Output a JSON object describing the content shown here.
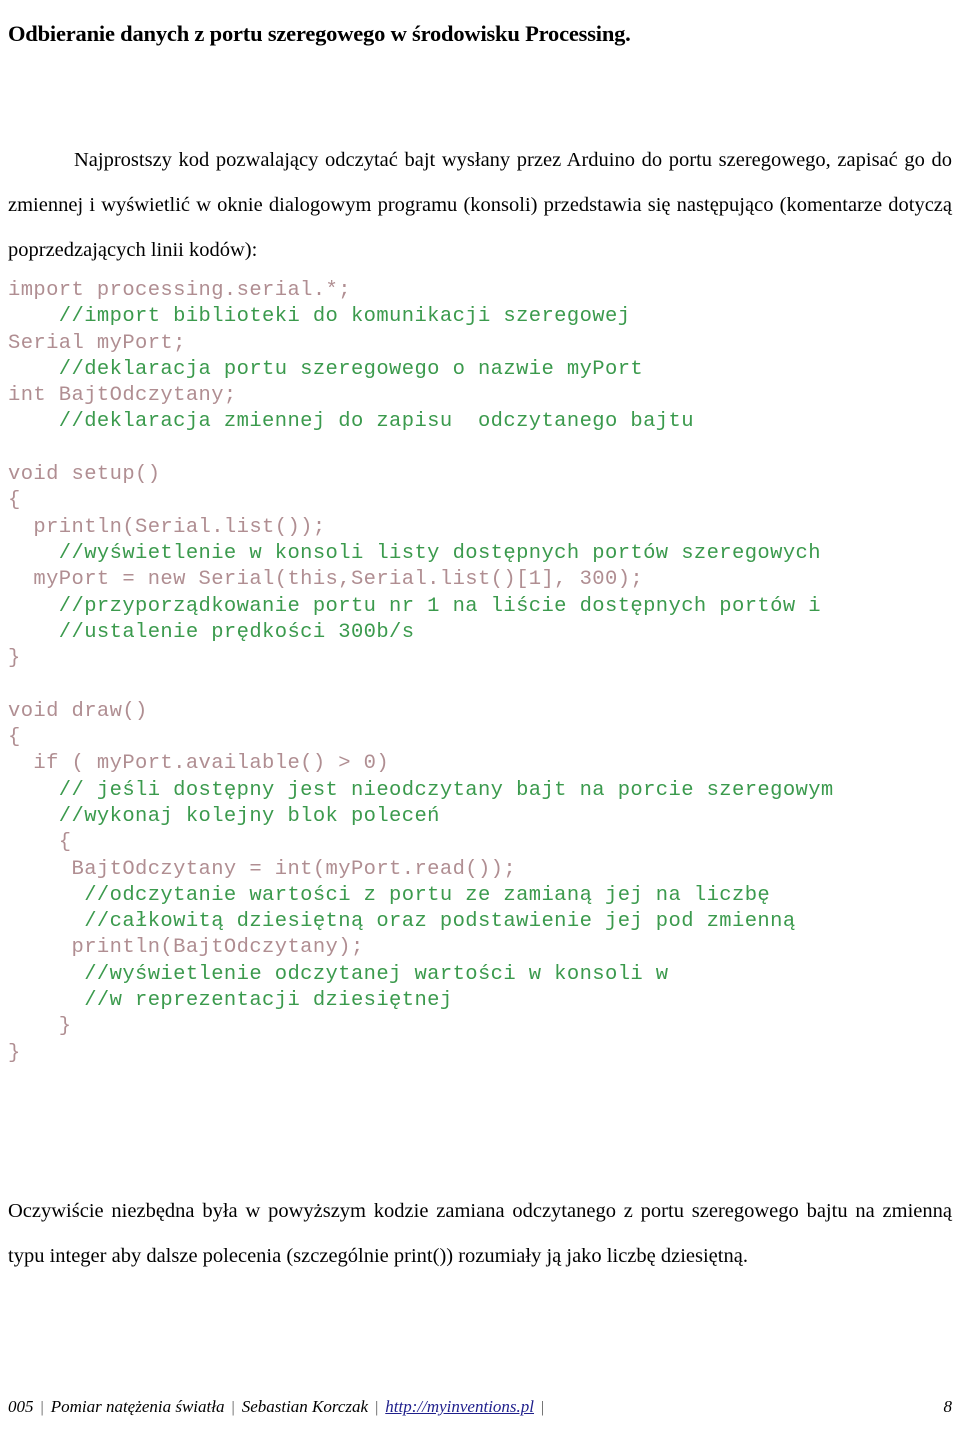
{
  "document": {
    "title": "Odbieranie danych z portu szeregowego w środowisku Processing.",
    "intro_paragraph": "Najprostszy kod pozwalający odczytać bajt wysłany przez Arduino do portu szeregowego, zapisać go do zmiennej i wyświetlić w oknie dialogowym programu (konsoli) przedstawia się następująco (komentarze dotyczą poprzedzających linii kodów):",
    "outro_paragraph": "Oczywiście niezbędna była w powyższym kodzie zamiana odczytanego z portu szeregowego bajtu na zmienną typu integer aby dalsze polecenia (szczególnie print()) rozumiały ją jako liczbę dziesiętną."
  },
  "colors": {
    "code": "#b08e92",
    "comment": "#3b9a4d",
    "link": "#1f1f8c",
    "text": "#000000",
    "background": "#ffffff"
  },
  "code_block": {
    "language": "Processing",
    "lines": [
      {
        "kind": "code",
        "text": "import processing.serial.*;"
      },
      {
        "kind": "comment",
        "text": "    //import biblioteki do komunikacji szeregowej"
      },
      {
        "kind": "code",
        "text": "Serial myPort;"
      },
      {
        "kind": "comment",
        "text": "    //deklaracja portu szeregowego o nazwie myPort"
      },
      {
        "kind": "code",
        "text": "int BajtOdczytany;"
      },
      {
        "kind": "comment",
        "text": "    //deklaracja zmiennej do zapisu  odczytanego bajtu"
      },
      {
        "kind": "blank",
        "text": " "
      },
      {
        "kind": "code",
        "text": "void setup()"
      },
      {
        "kind": "code",
        "text": "{"
      },
      {
        "kind": "code",
        "text": "  println(Serial.list());"
      },
      {
        "kind": "comment",
        "text": "    //wyświetlenie w konsoli listy dostępnych portów szeregowych"
      },
      {
        "kind": "code",
        "text": "  myPort = new Serial(this,Serial.list()[1], 300);"
      },
      {
        "kind": "comment",
        "text": "    //przyporządkowanie portu nr 1 na liście dostępnych portów i"
      },
      {
        "kind": "comment",
        "text": "    //ustalenie prędkości 300b/s"
      },
      {
        "kind": "code",
        "text": "}"
      },
      {
        "kind": "blank",
        "text": " "
      },
      {
        "kind": "code",
        "text": "void draw()"
      },
      {
        "kind": "code",
        "text": "{"
      },
      {
        "kind": "code",
        "text": "  if ( myPort.available() > 0)"
      },
      {
        "kind": "comment",
        "text": "    // jeśli dostępny jest nieodczytany bajt na porcie szeregowym"
      },
      {
        "kind": "comment",
        "text": "    //wykonaj kolejny blok poleceń"
      },
      {
        "kind": "code",
        "text": "    {"
      },
      {
        "kind": "code",
        "text": "     BajtOdczytany = int(myPort.read());"
      },
      {
        "kind": "comment",
        "text": "      //odczytanie wartości z portu ze zamianą jej na liczbę"
      },
      {
        "kind": "comment",
        "text": "      //całkowitą dziesiętną oraz podstawienie jej pod zmienną"
      },
      {
        "kind": "code",
        "text": "     println(BajtOdczytany);"
      },
      {
        "kind": "comment",
        "text": "      //wyświetlenie odczytanej wartości w konsoli w"
      },
      {
        "kind": "comment",
        "text": "      //w reprezentacji dziesiętnej"
      },
      {
        "kind": "code",
        "text": "    }"
      },
      {
        "kind": "code",
        "text": "}"
      }
    ]
  },
  "footer": {
    "number": "005",
    "separator": "|",
    "project": "Pomiar natężenia światła",
    "author": "Sebastian Korczak",
    "url": "http://myinventions.pl",
    "page": "8"
  }
}
